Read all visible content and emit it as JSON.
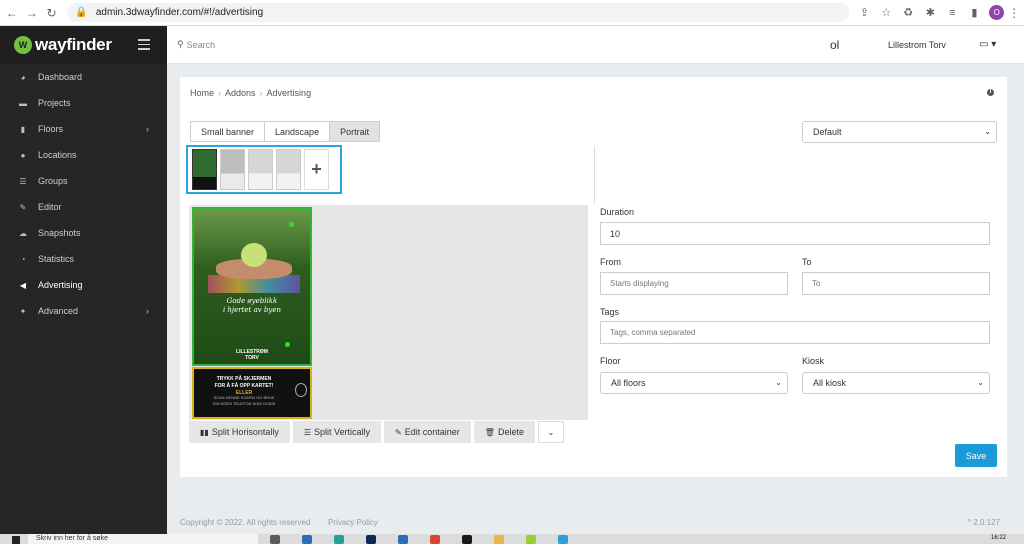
{
  "browser": {
    "url": "admin.3dwayfinder.com/#!/advertising",
    "profile_initial": "O"
  },
  "sidebar": {
    "brand": "wayfinder",
    "items": [
      {
        "label": "Dashboard",
        "icon": "dashboard-icon"
      },
      {
        "label": "Projects",
        "icon": "briefcase-icon"
      },
      {
        "label": "Floors",
        "icon": "building-icon"
      },
      {
        "label": "Locations",
        "icon": "map-marker-icon"
      },
      {
        "label": "Groups",
        "icon": "list-icon"
      },
      {
        "label": "Editor",
        "icon": "edit-icon"
      },
      {
        "label": "Snapshots",
        "icon": "cloud-upload-icon"
      },
      {
        "label": "Statistics",
        "icon": "pie-chart-icon"
      },
      {
        "label": "Advertising",
        "icon": "bullhorn-icon"
      },
      {
        "label": "Advanced",
        "icon": "wrench-icon"
      }
    ],
    "active": "Advertising"
  },
  "topbar": {
    "search_placeholder": "Search",
    "user_initials": "ol",
    "venue": "Lillestrom Torv"
  },
  "breadcrumb": [
    "Home",
    "Addons",
    "Advertising"
  ],
  "tabs": [
    "Small banner",
    "Landscape",
    "Portrait"
  ],
  "active_tab": "Portrait",
  "layout_select": "Default",
  "poster": {
    "script_line1": "Gode øyeblikk",
    "script_line2": "i hjertet av byen",
    "brand_line1": "LILLESTRØM",
    "brand_line2": "TORV",
    "cta_line1": "TRYKK PÅ SKJERMEN",
    "cta_line2": "FOR Å FÅ OPP KARTET!",
    "cta_line3": "ELLER",
    "cta_line4": "SCAN DENNE KODEN OG BRUK",
    "cta_line5": "DIN EGEN TELEFON SOM GUIDE"
  },
  "actions": {
    "split_h": "Split Horisontally",
    "split_v": "Split Vertically",
    "edit": "Edit container",
    "delete": "Delete"
  },
  "form": {
    "duration_label": "Duration",
    "duration_value": "10",
    "from_label": "From",
    "from_placeholder": "Starts displaying",
    "to_label": "To",
    "to_placeholder": "To",
    "tags_label": "Tags",
    "tags_placeholder": "Tags, comma separated",
    "floor_label": "Floor",
    "floor_value": "All floors",
    "kiosk_label": "Kiosk",
    "kiosk_value": "All kiosk",
    "save": "Save"
  },
  "footer": {
    "copyright": "Copyright © 2022. All rights reserved",
    "policy": "Privacy Policy",
    "version": "^ 2.0.127"
  },
  "taskbar": {
    "search": "Skriv inn her for å søke",
    "time": "16:22"
  }
}
